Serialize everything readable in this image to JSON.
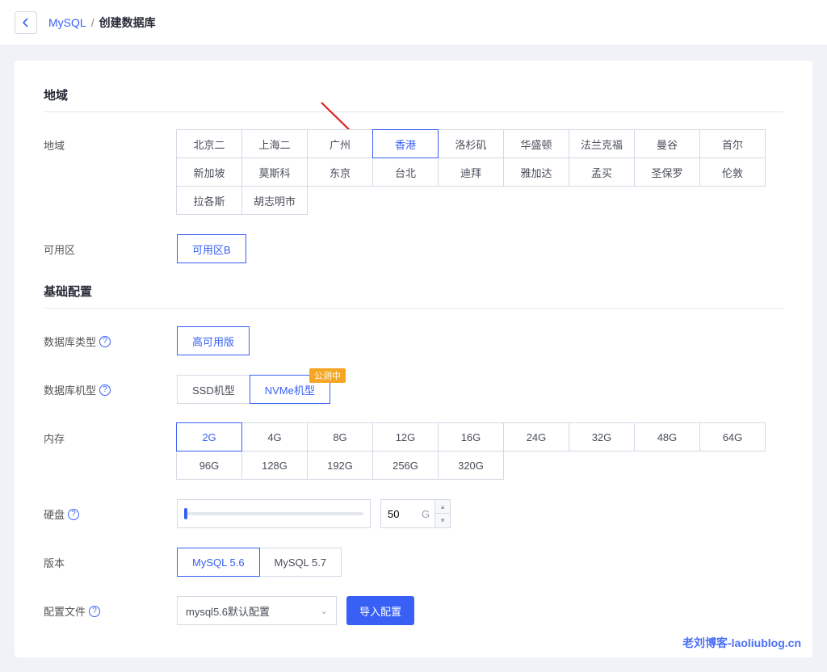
{
  "breadcrumb": {
    "parent": "MySQL",
    "separator": "/",
    "current": "创建数据库"
  },
  "sections": {
    "region_title": "地域",
    "basic_title": "基础配置"
  },
  "labels": {
    "region": "地域",
    "zone": "可用区",
    "db_type": "数据库类型",
    "db_model": "数据库机型",
    "memory": "内存",
    "disk": "硬盘",
    "version": "版本",
    "config_file": "配置文件"
  },
  "regions": [
    "北京二",
    "上海二",
    "广州",
    "香港",
    "洛杉矶",
    "华盛顿",
    "法兰克福",
    "曼谷",
    "首尔",
    "新加坡",
    "莫斯科",
    "东京",
    "台北",
    "迪拜",
    "雅加达",
    "孟买",
    "圣保罗",
    "伦敦",
    "拉各斯",
    "胡志明市"
  ],
  "region_selected": "香港",
  "zones": [
    "可用区B"
  ],
  "zone_selected": "可用区B",
  "db_types": [
    "高可用版"
  ],
  "db_type_selected": "高可用版",
  "db_models": [
    {
      "name": "SSD机型",
      "badge": null
    },
    {
      "name": "NVMe机型",
      "badge": "公测中"
    }
  ],
  "db_model_selected": "NVMe机型",
  "memory": [
    "2G",
    "4G",
    "8G",
    "12G",
    "16G",
    "24G",
    "32G",
    "48G",
    "64G",
    "96G",
    "128G",
    "192G",
    "256G",
    "320G"
  ],
  "memory_selected": "2G",
  "disk": {
    "value": "50",
    "unit": "G"
  },
  "versions": [
    "MySQL 5.6",
    "MySQL 5.7"
  ],
  "version_selected": "MySQL 5.6",
  "config_select": "mysql5.6默认配置",
  "import_button": "导入配置",
  "watermark": "老刘博客-laoliublog.cn"
}
